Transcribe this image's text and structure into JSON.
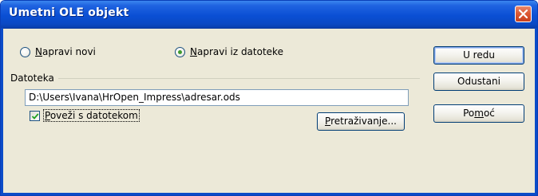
{
  "window": {
    "title": "Umetni OLE objekt"
  },
  "radios": {
    "create_new": {
      "label_first": "N",
      "label_rest": "apravi novi",
      "selected": false
    },
    "from_file": {
      "label_first": "N",
      "label_rest": "apravi iz datoteke",
      "selected": true
    }
  },
  "file_group": {
    "label": "Datoteka",
    "path_value": "D:\\Users\\Ivana\\HrOpen_Impress\\adresar.ods",
    "link_checkbox": {
      "label_first": "P",
      "label_rest": "oveži s datotekom",
      "checked": true
    },
    "browse_button": {
      "label_first": "P",
      "label_rest": "retraživanje..."
    }
  },
  "buttons": {
    "ok": "U redu",
    "cancel": "Odustani",
    "help_pre": "Po",
    "help_u": "m",
    "help_post": "oć"
  },
  "colors": {
    "titlebar": "#0a4fd4",
    "dialog_bg": "#ece9d8",
    "close_button": "#dd5a35",
    "radio_dot": "#3f9a30"
  },
  "icons": {
    "close": "close-icon",
    "check": "checkmark-icon"
  }
}
